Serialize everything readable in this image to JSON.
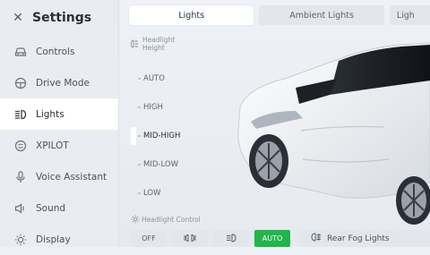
{
  "header": {
    "title": "Settings",
    "close_icon": "close-icon"
  },
  "sidebar": {
    "items": [
      {
        "label": "Controls",
        "icon": "car-icon",
        "active": false
      },
      {
        "label": "Drive Mode",
        "icon": "steering-wheel-icon",
        "active": false
      },
      {
        "label": "Lights",
        "icon": "headlight-icon",
        "active": true
      },
      {
        "label": "XPILOT",
        "icon": "autopilot-icon",
        "active": false
      },
      {
        "label": "Voice Assistant",
        "icon": "microphone-icon",
        "active": false
      },
      {
        "label": "Sound",
        "icon": "speaker-icon",
        "active": false
      },
      {
        "label": "Display",
        "icon": "brightness-icon",
        "active": false
      }
    ]
  },
  "tabs": [
    {
      "label": "Lights",
      "active": true
    },
    {
      "label": "Ambient Lights",
      "active": false
    },
    {
      "label": "Ligh",
      "active": false
    }
  ],
  "headlight_height": {
    "label": "Headlight Height",
    "options": [
      "AUTO",
      "HIGH",
      "MID-HIGH",
      "MID-LOW",
      "LOW"
    ],
    "selected": "MID-HIGH"
  },
  "headlight_control": {
    "label": "Headlight Control",
    "buttons": [
      {
        "label": "OFF",
        "active": false
      },
      {
        "label": "⧘ ⧙",
        "icon": "parking-light-icon",
        "active": false
      },
      {
        "label": "≣D",
        "icon": "low-beam-icon",
        "active": false
      },
      {
        "label": "AUTO",
        "active": true
      }
    ]
  },
  "rear_fog": {
    "label": "Rear Fog Lights",
    "icon": "rear-fog-light-icon"
  },
  "colors": {
    "accent_green": "#21b54b",
    "active_bg": "#ffffff"
  }
}
